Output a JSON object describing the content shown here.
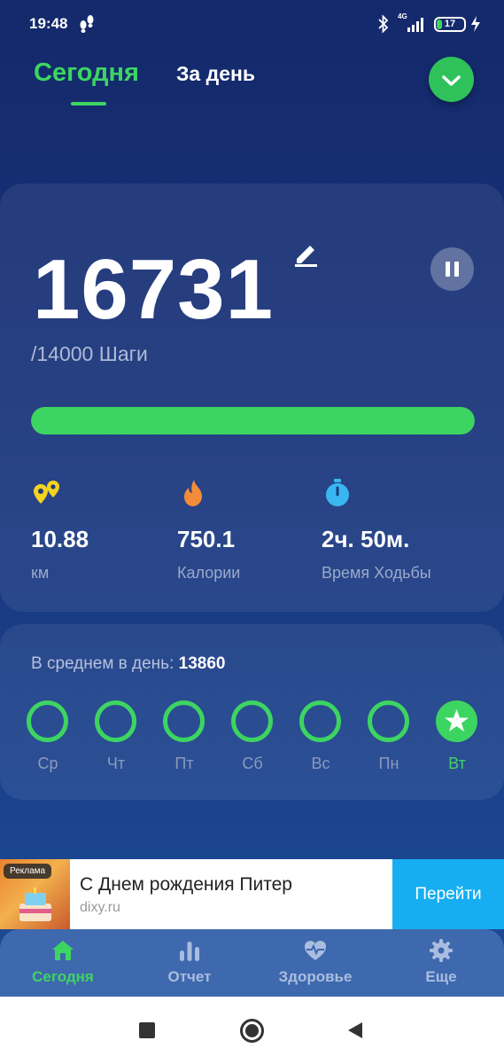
{
  "status_bar": {
    "time": "19:48",
    "network": "4G",
    "battery": "17",
    "icons": [
      "footsteps-icon",
      "bluetooth-icon",
      "signal-icon",
      "battery-icon",
      "charging-icon"
    ]
  },
  "header": {
    "tab_today": "Сегодня",
    "tab_day": "За день",
    "action_icon": "chevron-down-icon"
  },
  "steps": {
    "value": "16731",
    "goal_text": "/14000 Шаги",
    "progress": 1.0,
    "edit_icon": "pencil-icon",
    "pause_icon": "pause-icon"
  },
  "stats": [
    {
      "icon": "distance-icon",
      "value": "10.88",
      "label": "км",
      "color": "#f5d31d"
    },
    {
      "icon": "flame-icon",
      "value": "750.1",
      "label": "Калории",
      "color": "#f28c3b"
    },
    {
      "icon": "stopwatch-icon",
      "value": "2ч. 50м.",
      "label": "Время Ходьбы",
      "color": "#3ab7f0"
    }
  ],
  "week": {
    "avg_label": "В среднем в день:",
    "avg_value": "13860",
    "days": [
      {
        "label": "Ср",
        "goal_met": true
      },
      {
        "label": "Чт",
        "goal_met": true
      },
      {
        "label": "Пт",
        "goal_met": true
      },
      {
        "label": "Сб",
        "goal_met": true
      },
      {
        "label": "Вс",
        "goal_met": true
      },
      {
        "label": "Пн",
        "goal_met": true
      },
      {
        "label": "Вт",
        "goal_met": true,
        "today": true
      }
    ]
  },
  "ad": {
    "badge": "Реклама",
    "title": "С Днем рождения Питер",
    "domain": "dixy.ru",
    "button": "Перейти"
  },
  "bottom_nav": [
    {
      "label": "Сегодня",
      "icon": "home-icon",
      "active": true
    },
    {
      "label": "Отчет",
      "icon": "bar-chart-icon",
      "active": false
    },
    {
      "label": "Здоровье",
      "icon": "heart-pulse-icon",
      "active": false
    },
    {
      "label": "Еще",
      "icon": "gear-icon",
      "active": false
    }
  ],
  "colors": {
    "accent": "#3dd561",
    "background_top": "#14296b",
    "background_bottom": "#204c98",
    "ad_button": "#16aef0"
  }
}
